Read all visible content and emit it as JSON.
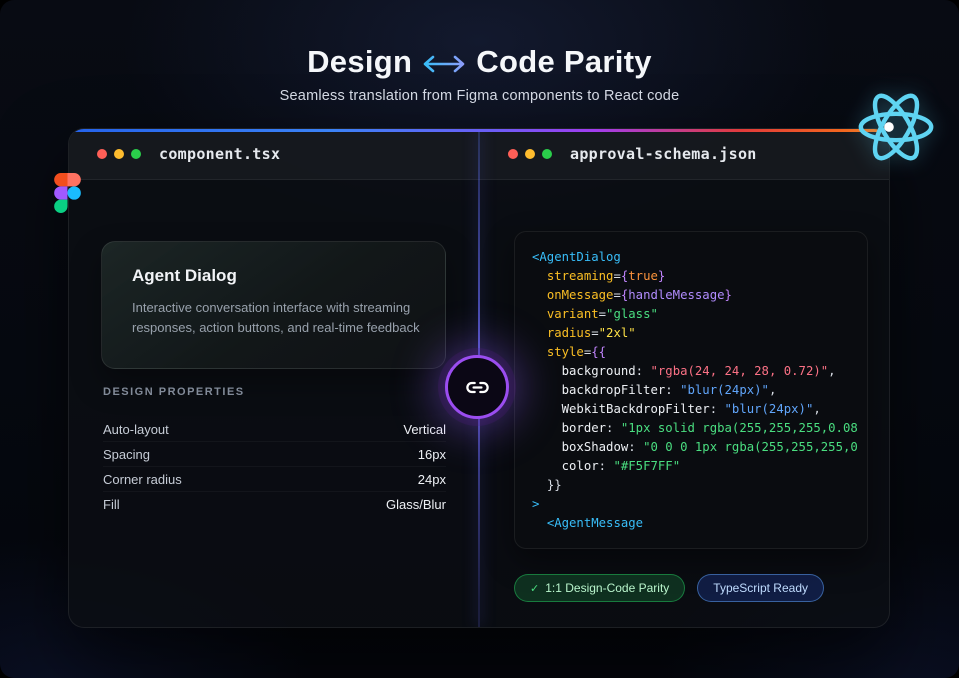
{
  "page": {
    "title": {
      "left": "Design",
      "arrow": "↔",
      "right": "Code Parity"
    },
    "subtitle": "Seamless translation from Figma components to React code"
  },
  "left_panel": {
    "filename": "component.tsx",
    "card": {
      "title": "Agent Dialog",
      "description": "Interactive conversation interface with streaming responses, action buttons, and real-time feedback"
    },
    "properties_heading": "DESIGN PROPERTIES",
    "properties": [
      {
        "label": "Auto-layout",
        "value": "Vertical"
      },
      {
        "label": "Spacing",
        "value": "16px"
      },
      {
        "label": "Corner radius",
        "value": "24px"
      },
      {
        "label": "Fill",
        "value": "Glass/Blur"
      }
    ]
  },
  "right_panel": {
    "filename": "approval-schema.json",
    "code_lines": [
      [
        {
          "t": "tag",
          "s": "<AgentDialog"
        }
      ],
      [
        {
          "t": "plain",
          "s": "  "
        },
        {
          "t": "attr",
          "s": "streaming"
        },
        {
          "t": "punct",
          "s": "="
        },
        {
          "t": "brace",
          "s": "{"
        },
        {
          "t": "value",
          "s": "true"
        },
        {
          "t": "brace",
          "s": "}"
        }
      ],
      [
        {
          "t": "plain",
          "s": "  "
        },
        {
          "t": "attr",
          "s": "onMessage"
        },
        {
          "t": "punct",
          "s": "="
        },
        {
          "t": "brace",
          "s": "{"
        },
        {
          "t": "ident",
          "s": "handleMessage"
        },
        {
          "t": "brace",
          "s": "}"
        }
      ],
      [
        {
          "t": "plain",
          "s": "  "
        },
        {
          "t": "attr",
          "s": "variant"
        },
        {
          "t": "punct",
          "s": "="
        },
        {
          "t": "strGreen",
          "s": "\"glass\""
        }
      ],
      [
        {
          "t": "plain",
          "s": "  "
        },
        {
          "t": "attr",
          "s": "radius"
        },
        {
          "t": "punct",
          "s": "="
        },
        {
          "t": "strYellow",
          "s": "\"2xl\""
        }
      ],
      [
        {
          "t": "plain",
          "s": "  "
        },
        {
          "t": "attr",
          "s": "style"
        },
        {
          "t": "punct",
          "s": "="
        },
        {
          "t": "brace",
          "s": "{{"
        }
      ],
      [
        {
          "t": "plain",
          "s": "    "
        },
        {
          "t": "prop",
          "s": "background"
        },
        {
          "t": "punct",
          "s": ": "
        },
        {
          "t": "strRed",
          "s": "\"rgba(24, 24, 28, 0.72)\""
        },
        {
          "t": "punct",
          "s": ","
        }
      ],
      [
        {
          "t": "plain",
          "s": "    "
        },
        {
          "t": "prop",
          "s": "backdropFilter"
        },
        {
          "t": "punct",
          "s": ": "
        },
        {
          "t": "strBlue",
          "s": "\"blur(24px)\""
        },
        {
          "t": "punct",
          "s": ","
        }
      ],
      [
        {
          "t": "plain",
          "s": "    "
        },
        {
          "t": "prop",
          "s": "WebkitBackdropFilter"
        },
        {
          "t": "punct",
          "s": ": "
        },
        {
          "t": "strBlue",
          "s": "\"blur(24px)\""
        },
        {
          "t": "punct",
          "s": ","
        }
      ],
      [
        {
          "t": "plain",
          "s": "    "
        },
        {
          "t": "prop",
          "s": "border"
        },
        {
          "t": "punct",
          "s": ": "
        },
        {
          "t": "strGreen",
          "s": "\"1px solid rgba(255,255,255,0.08"
        }
      ],
      [
        {
          "t": "plain",
          "s": "    "
        },
        {
          "t": "prop",
          "s": "boxShadow"
        },
        {
          "t": "punct",
          "s": ": "
        },
        {
          "t": "strGreen",
          "s": "\"0 0 0 1px rgba(255,255,255,0"
        }
      ],
      [
        {
          "t": "plain",
          "s": "    "
        },
        {
          "t": "prop",
          "s": "color"
        },
        {
          "t": "punct",
          "s": ": "
        },
        {
          "t": "strGreen",
          "s": "\"#F5F7FF\""
        }
      ],
      [
        {
          "t": "plain",
          "s": "  "
        },
        {
          "t": "punct",
          "s": "}}"
        }
      ],
      [
        {
          "t": "tag",
          "s": ">"
        }
      ],
      [
        {
          "t": "plain",
          "s": "  "
        },
        {
          "t": "tag",
          "s": "<AgentMessage"
        }
      ]
    ],
    "badges": [
      {
        "icon": "✓",
        "label": "1:1 Design-Code Parity",
        "style": "green"
      },
      {
        "label": "TypeScript Ready",
        "style": "blue"
      }
    ]
  },
  "colors": {
    "accent_blue": "#3b82f6",
    "accent_purple": "#8b5cf6",
    "accent_red": "#ef4444",
    "accent_orange": "#f97316",
    "react_cyan": "#61dafb",
    "badge_green": "#22c55e",
    "badge_blue": "#3b82f6",
    "figma_palette": [
      "#f24e1e",
      "#ff7262",
      "#a259ff",
      "#1abcfe",
      "#0acf83"
    ]
  }
}
